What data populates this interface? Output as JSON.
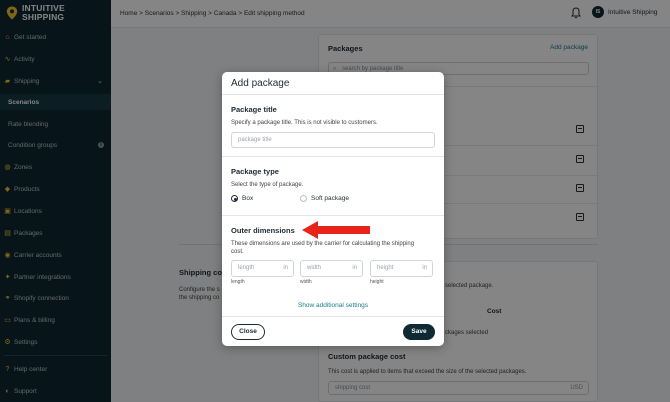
{
  "brand": {
    "line1": "INTUITIVE",
    "line2": "SHIPPING",
    "accent": "#f2c230",
    "sidebar_bg": "#0f2a33"
  },
  "sidebar": {
    "items": [
      {
        "label": "Get started",
        "icon": "home-icon"
      },
      {
        "label": "Activity",
        "icon": "activity-icon"
      },
      {
        "label": "Shipping",
        "icon": "truck-icon"
      },
      {
        "label": "Scenarios"
      },
      {
        "label": "Rate blending"
      },
      {
        "label": "Condition groups"
      },
      {
        "label": "Zones",
        "icon": "globe-icon"
      },
      {
        "label": "Products",
        "icon": "box-icon"
      },
      {
        "label": "Locations",
        "icon": "location-icon"
      },
      {
        "label": "Packages",
        "icon": "package-icon"
      },
      {
        "label": "Carrier accounts",
        "icon": "carrier-icon"
      },
      {
        "label": "Partner integrations",
        "icon": "integration-icon"
      },
      {
        "label": "Shopify connection",
        "icon": "shopify-icon"
      },
      {
        "label": "Plans & billing",
        "icon": "billing-icon"
      },
      {
        "label": "Settings",
        "icon": "gear-icon"
      },
      {
        "label": "Help center",
        "icon": "help-icon"
      },
      {
        "label": "Support",
        "icon": "support-icon"
      }
    ]
  },
  "topbar": {
    "breadcrumb": "Home > Scenarios > Shipping > Canada > Edit shipping method",
    "avatar_initials": "IS",
    "user_name": "Intuitive Shipping"
  },
  "background": {
    "packages_title": "Packages",
    "add_package_link": "Add package",
    "search_placeholder": "search by package title",
    "shipping_cost_title": "Shipping co",
    "shipping_cost_desc_1": "Configure the s",
    "shipping_cost_desc_2": "the shipping co",
    "selected_package_text": "selected package.",
    "cost_header": "Cost",
    "packages_selected": "ckages selected",
    "custom_cost_title": "Custom package cost",
    "custom_cost_desc": "This cost is applied to items that exceed the size of the selected packages.",
    "shipping_cost_placeholder": "shipping cost",
    "currency": "USD"
  },
  "modal": {
    "title": "Add package",
    "package_title_heading": "Package title",
    "package_title_desc": "Specify a package title. This is not visible to customers.",
    "package_title_placeholder": "package title",
    "package_type_heading": "Package type",
    "package_type_desc": "Select the type of package.",
    "type_box": "Box",
    "type_soft": "Soft package",
    "outer_heading": "Outer dimensions",
    "outer_desc_1": "These dimensions are used by the carrier for calculating the shipping",
    "outer_desc_2": "cost.",
    "length_placeholder": "length",
    "width_placeholder": "width",
    "height_placeholder": "height",
    "unit": "in",
    "length_caption": "length",
    "width_caption": "width",
    "height_caption": "height",
    "show_settings": "Show additional settings",
    "close_label": "Close",
    "save_label": "Save"
  },
  "annotation": {
    "arrow_color": "#e8231a"
  }
}
